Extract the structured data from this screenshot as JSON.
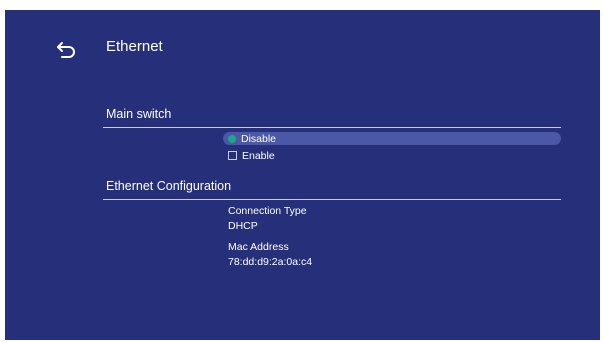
{
  "header": {
    "title": "Ethernet",
    "back_icon": "back-arrow-icon"
  },
  "main_switch": {
    "label": "Main switch",
    "options": [
      {
        "label": "Disable",
        "selected": true
      },
      {
        "label": "Enable",
        "selected": false
      }
    ]
  },
  "ethernet_config": {
    "label": "Ethernet Configuration",
    "connection_type_label": "Connection Type",
    "connection_type_value": "DHCP",
    "mac_address_label": "Mac Address",
    "mac_address_value": "78:dd:d9:2a:0a:c4"
  },
  "colors": {
    "background": "#26307a",
    "selection": "#4a58a6",
    "radio_selected": "#1aa88a"
  }
}
